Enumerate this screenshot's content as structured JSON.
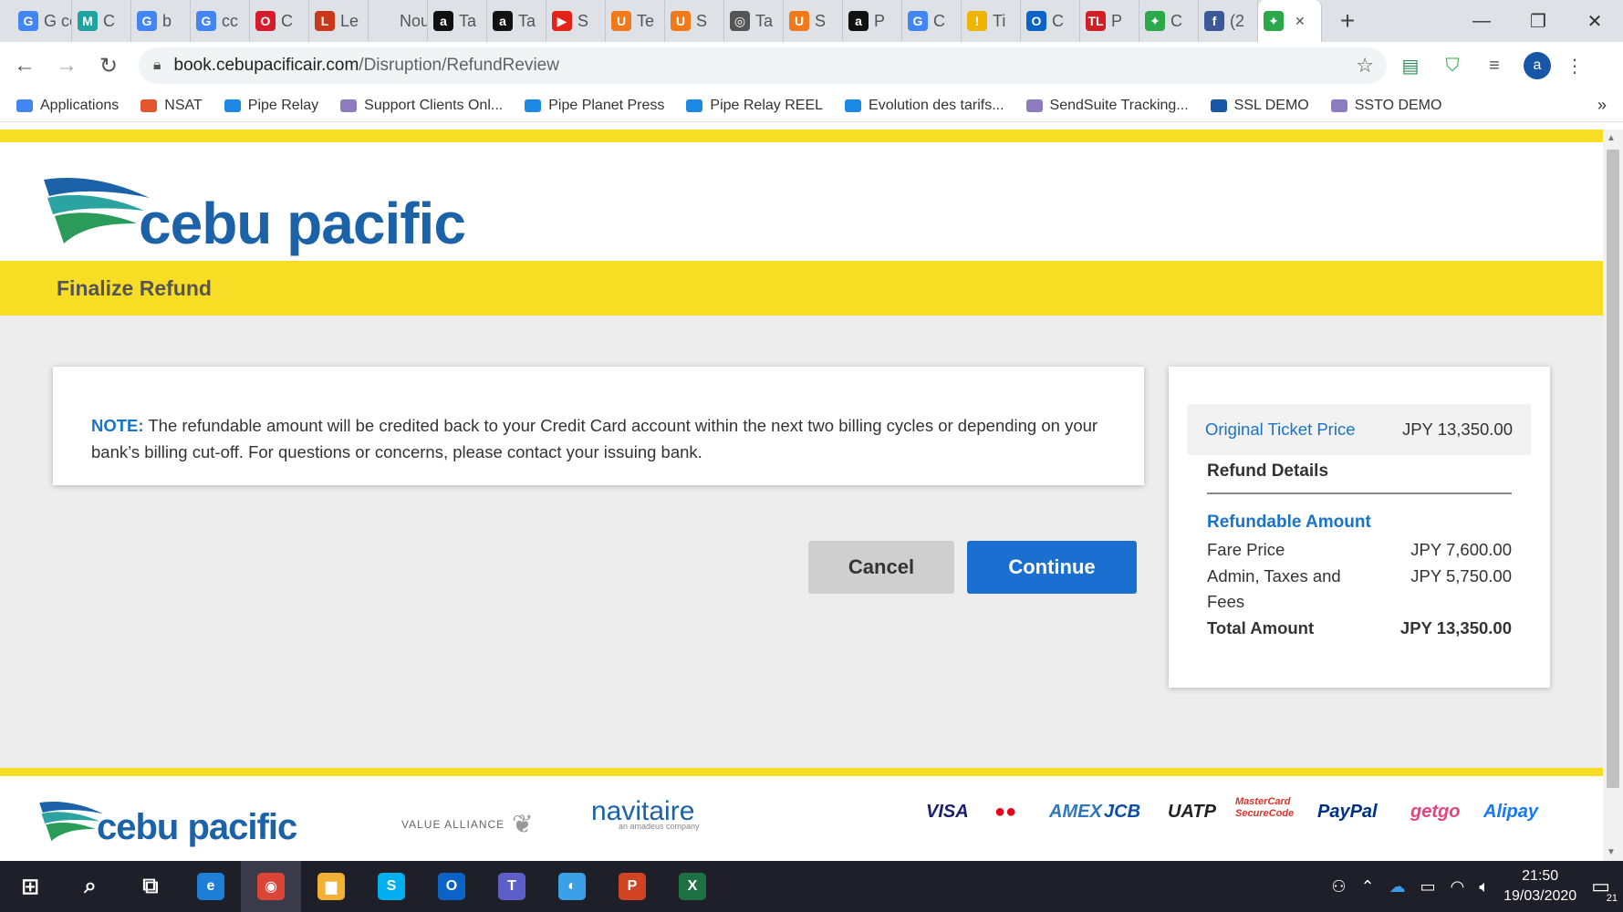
{
  "browser": {
    "tabs": [
      {
        "icon": "google-icon",
        "label": "G cc",
        "color": "#4285f4",
        "glyph": "G"
      },
      {
        "icon": "m-icon",
        "label": "C",
        "color": "#20a39e",
        "glyph": "M"
      },
      {
        "icon": "google-icon",
        "label": "b",
        "color": "#4285f4",
        "glyph": "G"
      },
      {
        "icon": "google-icon",
        "label": "cc",
        "color": "#4285f4",
        "glyph": "G"
      },
      {
        "icon": "opera-icon",
        "label": "C",
        "color": "#d61b2a",
        "glyph": "O"
      },
      {
        "icon": "office-icon",
        "label": "Le",
        "color": "#c9381c",
        "glyph": "L"
      },
      {
        "icon": "blank-icon",
        "label": "Nouv",
        "color": "#dee1e6",
        "glyph": ""
      },
      {
        "icon": "amazon-icon",
        "label": "Ta",
        "color": "#111111",
        "glyph": "a"
      },
      {
        "icon": "amazon-icon",
        "label": "Ta",
        "color": "#111111",
        "glyph": "a"
      },
      {
        "icon": "youtube-icon",
        "label": "S",
        "color": "#e62117",
        "glyph": "▶"
      },
      {
        "icon": "u-icon",
        "label": "Te",
        "color": "#f07a1a",
        "glyph": "U"
      },
      {
        "icon": "u-icon",
        "label": "S",
        "color": "#f07a1a",
        "glyph": "U"
      },
      {
        "icon": "globe-icon",
        "label": "Ta",
        "color": "#555555",
        "glyph": "◎"
      },
      {
        "icon": "u-icon",
        "label": "S",
        "color": "#f07a1a",
        "glyph": "U"
      },
      {
        "icon": "amazon-icon",
        "label": "P",
        "color": "#111111",
        "glyph": "a"
      },
      {
        "icon": "google-icon",
        "label": "C",
        "color": "#4285f4",
        "glyph": "G"
      },
      {
        "icon": "warning-icon",
        "label": "Ti",
        "color": "#f0b400",
        "glyph": "!"
      },
      {
        "icon": "outlook-icon",
        "label": "C",
        "color": "#0a64c8",
        "glyph": "O"
      },
      {
        "icon": "tl-icon",
        "label": "P",
        "color": "#d01f26",
        "glyph": "TL"
      },
      {
        "icon": "bird-icon",
        "label": "C",
        "color": "#2aa84a",
        "glyph": "✦"
      },
      {
        "icon": "facebook-icon",
        "label": "(2",
        "color": "#3b5998",
        "glyph": "f"
      },
      {
        "icon": "bird-icon",
        "label": "",
        "color": "#2aa84a",
        "glyph": "✦"
      }
    ],
    "new_tab_glyph": "+",
    "url_domain": "book.cebupacificair.com",
    "url_path": "/Disruption/RefundReview",
    "avatar_letter": "a",
    "bookmarks": [
      {
        "label": "Applications",
        "color": "#4285f4"
      },
      {
        "label": "NSAT",
        "color": "#e4572e"
      },
      {
        "label": "Pipe Relay",
        "color": "#1e88e5"
      },
      {
        "label": "Support Clients Onl...",
        "color": "#8e7cc3"
      },
      {
        "label": "Pipe Planet Press",
        "color": "#1e88e5"
      },
      {
        "label": "Pipe Relay REEL",
        "color": "#1e88e5"
      },
      {
        "label": "Evolution des tarifs...",
        "color": "#1e88e5"
      },
      {
        "label": "SendSuite Tracking...",
        "color": "#8e7cc3"
      },
      {
        "label": "SSL DEMO",
        "color": "#1a56a8"
      },
      {
        "label": "SSTO DEMO",
        "color": "#8e7cc3"
      }
    ],
    "bookmarks_more": "»"
  },
  "site": {
    "logo_text": "cebu pacific",
    "section_title": "Finalize Refund",
    "note_label": "NOTE:",
    "note_text": "The refundable amount will be credited back to your Credit Card account within the next two billing cycles or depending on your bank’s billing cut-off. For questions or concerns, please contact your issuing bank.",
    "cancel_label": "Cancel",
    "continue_label": "Continue",
    "summary": {
      "original_label": "Original Ticket Price",
      "original_value": "JPY 13,350.00",
      "details_heading": "Refund Details",
      "refundable_heading": "Refundable Amount",
      "rows": [
        {
          "label": "Fare Price",
          "value": "JPY 7,600.00"
        },
        {
          "label": "Admin, Taxes and Fees",
          "value": "JPY 5,750.00"
        }
      ],
      "total_label": "Total Amount",
      "total_value": "JPY 13,350.00"
    },
    "footer": {
      "value_alliance": "VALUE ALLIANCE",
      "navitaire": "navitaire",
      "navitaire_sub": "an amadeus company",
      "payments": [
        {
          "label": "VISA",
          "color": "#1a1f71"
        },
        {
          "label": "●●",
          "color": "#eb001b"
        },
        {
          "label": "AMEX",
          "color": "#2e77bb"
        },
        {
          "label": "JCB",
          "color": "#0b4ea2"
        },
        {
          "label": "UATP",
          "color": "#222222"
        },
        {
          "label": "MasterCard SecureCode",
          "color": "#d8332a"
        },
        {
          "label": "PayPal",
          "color": "#003087"
        },
        {
          "label": "getgo",
          "color": "#e8417b"
        },
        {
          "label": "Alipay",
          "color": "#1677ff"
        }
      ]
    }
  },
  "taskbar": {
    "apps": [
      {
        "name": "start-icon",
        "glyph": "⊞",
        "color": "transparent"
      },
      {
        "name": "search-icon",
        "glyph": "⌕",
        "color": "transparent"
      },
      {
        "name": "task-view-icon",
        "glyph": "⧉",
        "color": "transparent"
      },
      {
        "name": "edge-icon",
        "glyph": "e",
        "color": "#1d7fd8"
      },
      {
        "name": "chrome-icon",
        "glyph": "◉",
        "color": "#db4437"
      },
      {
        "name": "explorer-icon",
        "glyph": "▆",
        "color": "#f2b134"
      },
      {
        "name": "skype-icon",
        "glyph": "S",
        "color": "#00aff0"
      },
      {
        "name": "outlook-icon",
        "glyph": "O",
        "color": "#0a64c8"
      },
      {
        "name": "teams-icon",
        "glyph": "T",
        "color": "#5b5fc7"
      },
      {
        "name": "chat-icon",
        "glyph": "◐",
        "color": "#3aa0e8"
      },
      {
        "name": "powerpoint-icon",
        "glyph": "P",
        "color": "#d04423"
      },
      {
        "name": "excel-icon",
        "glyph": "X",
        "color": "#1e7145"
      }
    ],
    "time": "21:50",
    "date": "19/03/2020",
    "notif_count": "21"
  },
  "colors": {
    "brand_yellow": "#f7dd24",
    "brand_blue": "#1b62a9",
    "link_blue": "#1a73c8",
    "continue_blue": "#1a6fd0"
  }
}
